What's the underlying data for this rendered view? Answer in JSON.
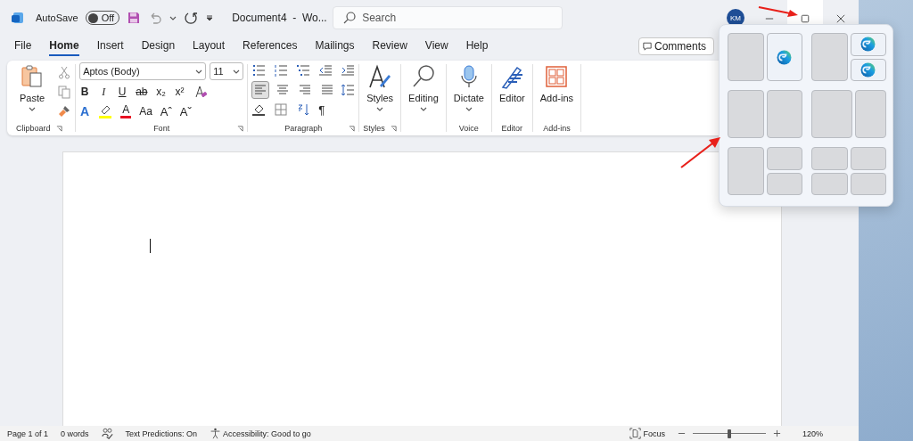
{
  "title_bar": {
    "autosave_label": "AutoSave",
    "autosave": {
      "on": false,
      "label": "Off"
    },
    "document_title": "Document4  -  Wo...",
    "search_placeholder": "Search",
    "avatar": "KM"
  },
  "tabs": [
    {
      "label": "File",
      "selected": false
    },
    {
      "label": "Home",
      "selected": true
    },
    {
      "label": "Insert",
      "selected": false
    },
    {
      "label": "Design",
      "selected": false
    },
    {
      "label": "Layout",
      "selected": false
    },
    {
      "label": "References",
      "selected": false
    },
    {
      "label": "Mailings",
      "selected": false
    },
    {
      "label": "Review",
      "selected": false
    },
    {
      "label": "View",
      "selected": false
    },
    {
      "label": "Help",
      "selected": false
    }
  ],
  "comments_button": "Comments",
  "clipboard": {
    "paste": "Paste",
    "label": "Clipboard"
  },
  "font": {
    "family": "Aptos (Body)",
    "size": "11",
    "label": "Font",
    "format_buttons": [
      {
        "kind": "bold",
        "glyph": "B"
      },
      {
        "kind": "italic",
        "glyph": "I"
      },
      {
        "kind": "underline",
        "glyph": "U"
      },
      {
        "kind": "strike",
        "glyph": "ab"
      },
      {
        "kind": "sub",
        "glyph": "x₂"
      },
      {
        "kind": "sup",
        "glyph": "x²"
      }
    ],
    "effect_buttons": [
      {
        "kind": "effects",
        "glyph": "A"
      },
      {
        "kind": "highlight"
      },
      {
        "kind": "color",
        "glyph": "A"
      },
      {
        "kind": "case",
        "glyph": "Aa"
      },
      {
        "kind": "grow",
        "glyph": "Aˆ"
      },
      {
        "kind": "shrink",
        "glyph": "Aˇ"
      }
    ]
  },
  "paragraph": {
    "label": "Paragraph",
    "alignments": [
      {
        "selected": true
      },
      {
        "selected": false
      },
      {
        "selected": false
      },
      {
        "selected": false
      }
    ],
    "show_marks": "¶"
  },
  "styles": {
    "button": "Styles",
    "label": "Styles"
  },
  "editing": {
    "button": "Editing"
  },
  "voice": {
    "button": "Dictate",
    "label": "Voice"
  },
  "editor": {
    "button": "Editor",
    "label": "Editor"
  },
  "addins": {
    "button": "Add-ins",
    "label": "Add-ins"
  },
  "status_bar": {
    "page": "Page 1 of 1",
    "words": "0 words",
    "predictions": "Text Predictions: On",
    "accessibility": "Accessibility: Good to go",
    "focus": "Focus",
    "zoom": {
      "level": 0.5,
      "reading": "120%"
    }
  }
}
